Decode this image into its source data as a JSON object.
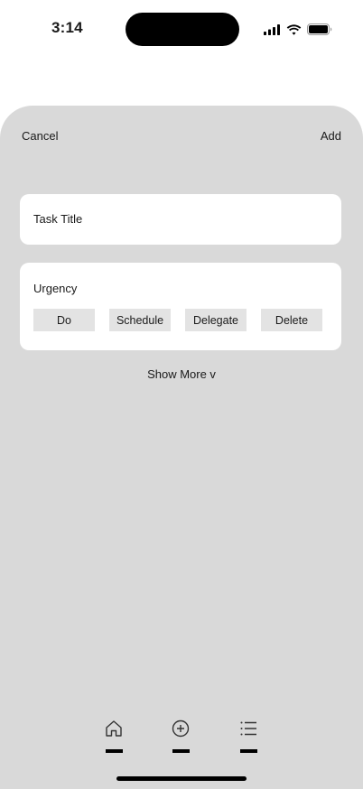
{
  "status_bar": {
    "time": "3:14"
  },
  "header": {
    "cancel_label": "Cancel",
    "add_label": "Add"
  },
  "form": {
    "title_placeholder": "Task Title",
    "urgency": {
      "label": "Urgency",
      "options": [
        "Do",
        "Schedule",
        "Delegate",
        "Delete"
      ]
    },
    "show_more_label": "Show More v"
  },
  "tabbar": {
    "tabs": [
      {
        "icon": "home-icon"
      },
      {
        "icon": "plus-circle-icon"
      },
      {
        "icon": "list-icon"
      }
    ]
  },
  "colors": {
    "sheet_background": "#d9d9d9",
    "card_background": "#ffffff",
    "option_background": "#e3e3e3",
    "text": "#1a1a1a"
  }
}
